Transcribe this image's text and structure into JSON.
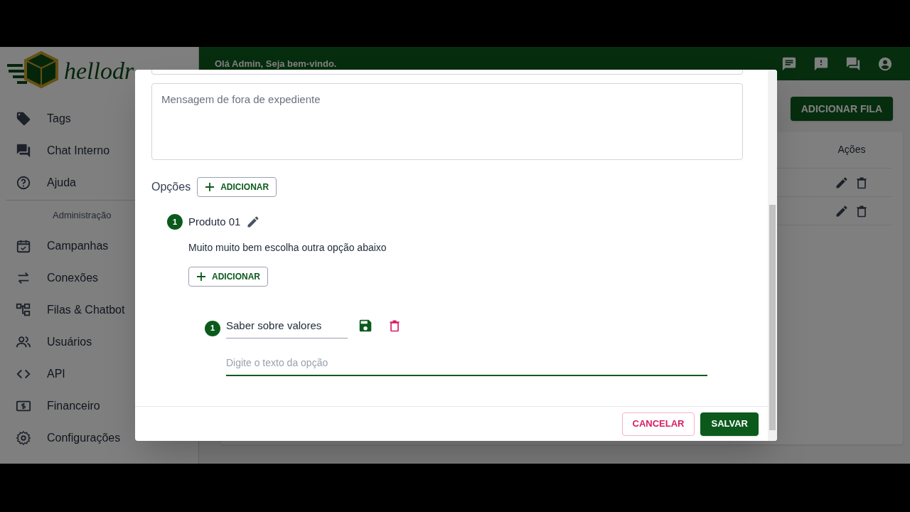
{
  "logo": {
    "text": "hellodr"
  },
  "header": {
    "greeting": "Olá Admin, Seja bem-vindo."
  },
  "sidebar": {
    "items": [
      {
        "label": "Tags"
      },
      {
        "label": "Chat Interno"
      },
      {
        "label": "Ajuda"
      }
    ],
    "section": "Administração",
    "admin_items": [
      {
        "label": "Campanhas"
      },
      {
        "label": "Conexões"
      },
      {
        "label": "Filas & Chatbot"
      },
      {
        "label": "Usuários"
      },
      {
        "label": "API"
      },
      {
        "label": "Financeiro"
      },
      {
        "label": "Configurações"
      }
    ]
  },
  "page": {
    "add_button": "ADICIONAR FILA",
    "table": {
      "columns": [
        "Ações"
      ],
      "rows": [
        {
          "kind": "actions"
        },
        {
          "kind": "actions"
        }
      ]
    }
  },
  "modal": {
    "message_field": {
      "placeholder": "Mensagem de fora de expediente"
    },
    "options": {
      "label": "Opções",
      "add_button": "ADICIONAR",
      "items": [
        {
          "number": "1",
          "title": "Produto 01",
          "message": "Muito muito bem escolha outra opção abaixo",
          "add_button": "ADICIONAR",
          "editing": false,
          "children": [
            {
              "number": "1",
              "title": "Saber sobre valores",
              "message_placeholder": "Digite o texto da opção",
              "editing": true,
              "focused": true
            }
          ]
        }
      ]
    },
    "buttons": [
      {
        "label": "CANCELAR",
        "kind": "cancel"
      },
      {
        "label": "SALVAR",
        "kind": "primary"
      }
    ]
  }
}
